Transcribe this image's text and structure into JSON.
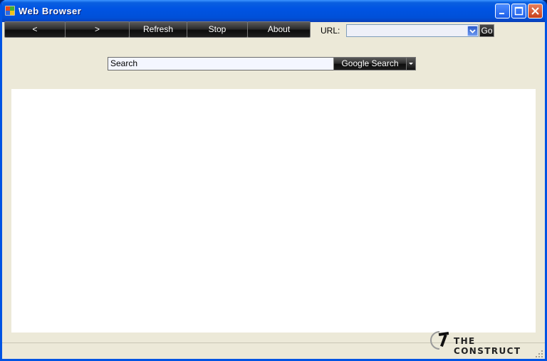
{
  "window": {
    "title": "Web  Browser"
  },
  "toolbar": {
    "back_label": "<",
    "forward_label": ">",
    "refresh_label": "Refresh",
    "stop_label": "Stop",
    "about_label": "About"
  },
  "url": {
    "label": "URL:",
    "value": "",
    "go_label": "Go"
  },
  "search": {
    "value": "Search",
    "button_label": "Google Search"
  },
  "branding": {
    "logo_text": "THE CONSTRUCT"
  },
  "colors": {
    "titlebar": "#0054e3",
    "form_bg": "#ece9d8",
    "button_bg": "#1a1a1a"
  }
}
